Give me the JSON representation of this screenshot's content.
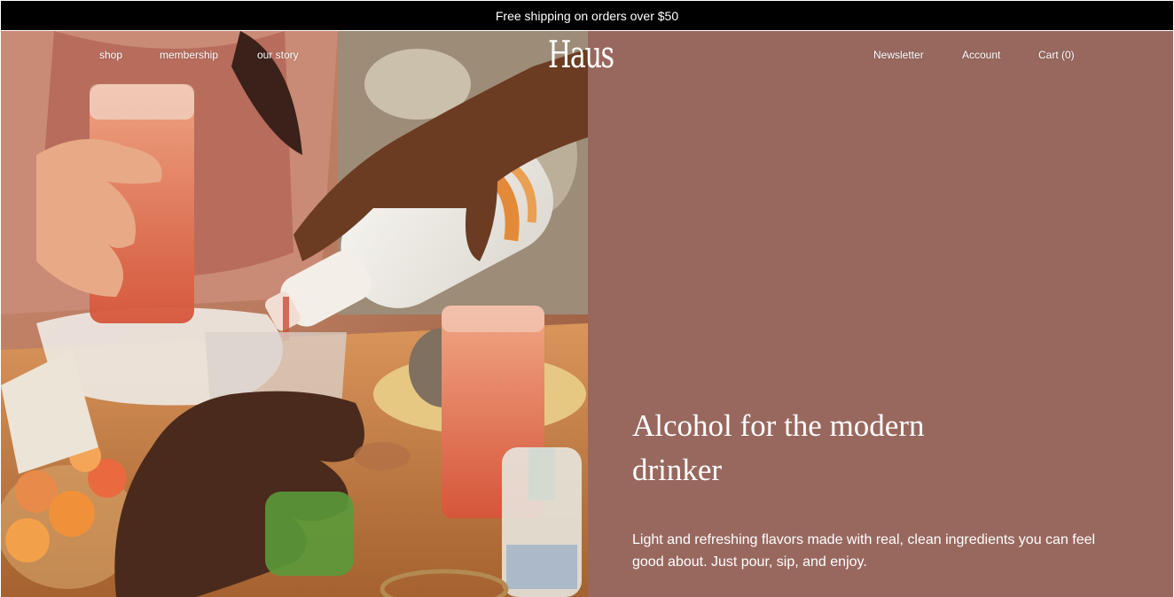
{
  "announcement": {
    "text": "Free shipping on orders over $50"
  },
  "nav": {
    "left": [
      {
        "label": "shop"
      },
      {
        "label": "membership"
      },
      {
        "label": "our story"
      }
    ],
    "logo": "Haus",
    "right": [
      {
        "label": "Newsletter"
      },
      {
        "label": "Account"
      },
      {
        "label": "Cart (0)"
      }
    ]
  },
  "hero": {
    "headline": "Alcohol for the modern drinker",
    "subcopy": "Light and refreshing flavors made with real, clean ingredients you can feel good about. Just pour, sip, and enjoy.",
    "image_alt": "Hands pouring an apéritif from a white bottle into glasses on a sunlit table",
    "colors": {
      "panel": "#98685f",
      "announcement_bar": "#000000",
      "text": "#ffffff"
    }
  }
}
